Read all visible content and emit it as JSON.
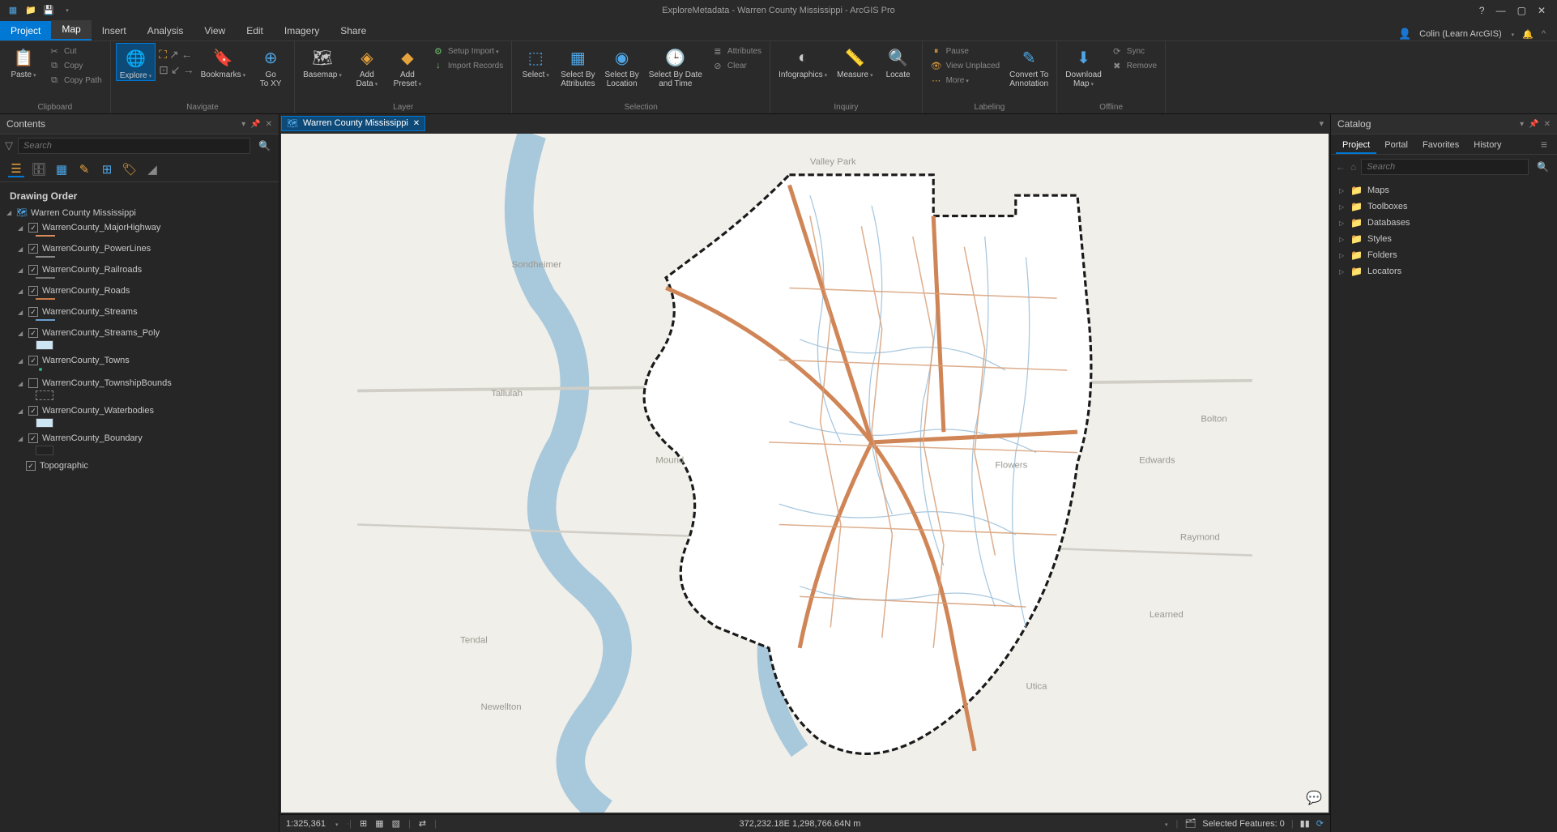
{
  "titlebar": {
    "title": "ExploreMetadata - Warren County Mississippi - ArcGIS Pro",
    "user": "Colin (Learn ArcGIS)"
  },
  "ribbon_tabs": {
    "file": "Project",
    "items": [
      "Map",
      "Insert",
      "Analysis",
      "View",
      "Edit",
      "Imagery",
      "Share"
    ],
    "active": "Map"
  },
  "ribbon": {
    "clipboard": {
      "label": "Clipboard",
      "paste": "Paste",
      "cut": "Cut",
      "copy": "Copy",
      "copypath": "Copy Path"
    },
    "navigate": {
      "label": "Navigate",
      "explore": "Explore",
      "bookmarks": "Bookmarks",
      "goto": "Go\nTo XY"
    },
    "layer": {
      "label": "Layer",
      "basemap": "Basemap",
      "adddata": "Add\nData",
      "addpreset": "Add\nPreset",
      "setupimport": "Setup Import",
      "importrecords": "Import Records"
    },
    "selection": {
      "label": "Selection",
      "select": "Select",
      "selectattr": "Select By\nAttributes",
      "selectloc": "Select By\nLocation",
      "selectdate": "Select By Date\nand Time",
      "attributes": "Attributes",
      "clear": "Clear"
    },
    "inquiry": {
      "label": "Inquiry",
      "infographics": "Infographics",
      "measure": "Measure",
      "locate": "Locate"
    },
    "labeling": {
      "label": "Labeling",
      "pause": "Pause",
      "unplaced": "View Unplaced",
      "more": "More",
      "convert": "Convert To\nAnnotation"
    },
    "offline": {
      "label": "Offline",
      "download": "Download\nMap",
      "sync": "Sync",
      "remove": "Remove"
    }
  },
  "contents": {
    "title": "Contents",
    "search_placeholder": "Search",
    "drawing_order": "Drawing Order",
    "map_name": "Warren County Mississippi",
    "layers": [
      {
        "name": "WarrenCounty_MajorHighway",
        "checked": true,
        "sym": "line",
        "color": "#d88c5c"
      },
      {
        "name": "WarrenCounty_PowerLines",
        "checked": true,
        "sym": "line",
        "color": "#888"
      },
      {
        "name": "WarrenCounty_Railroads",
        "checked": true,
        "sym": "line",
        "color": "#777"
      },
      {
        "name": "WarrenCounty_Roads",
        "checked": true,
        "sym": "line",
        "color": "#c77a4a"
      },
      {
        "name": "WarrenCounty_Streams",
        "checked": true,
        "sym": "line",
        "color": "#6a9ecb"
      },
      {
        "name": "WarrenCounty_Streams_Poly",
        "checked": true,
        "sym": "poly",
        "color": "#cde4f2"
      },
      {
        "name": "WarrenCounty_Towns",
        "checked": true,
        "sym": "point",
        "color": "#3a8"
      },
      {
        "name": "WarrenCounty_TownshipBounds",
        "checked": false,
        "sym": "poly",
        "color": "transparent"
      },
      {
        "name": "WarrenCounty_Waterbodies",
        "checked": true,
        "sym": "poly",
        "color": "#cde4f2"
      },
      {
        "name": "WarrenCounty_Boundary",
        "checked": true,
        "sym": "poly",
        "color": "#222"
      }
    ],
    "basemap": "Topographic"
  },
  "map": {
    "tab": "Warren County Mississippi",
    "scale": "1:325,361",
    "coords": "372,232.18E 1,298,766.64N m",
    "selected": "Selected Features: 0"
  },
  "catalog": {
    "title": "Catalog",
    "tabs": [
      "Project",
      "Portal",
      "Favorites",
      "History"
    ],
    "active": "Project",
    "search_placeholder": "Search",
    "items": [
      "Maps",
      "Toolboxes",
      "Databases",
      "Styles",
      "Folders",
      "Locators"
    ]
  }
}
